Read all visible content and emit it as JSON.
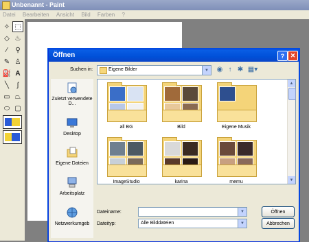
{
  "paint": {
    "title": "Unbenannt - Paint",
    "menu": [
      "Datei",
      "Bearbeiten",
      "Ansicht",
      "Bild",
      "Farben",
      "?"
    ]
  },
  "dialog": {
    "title": "Öffnen",
    "help_glyph": "?",
    "close_glyph": "✕",
    "look_in_label": "Suchen in:",
    "look_in_value": "Eigene Bilder",
    "places": [
      {
        "label": "Zuletzt verwendete D...",
        "icon": "recent-icon"
      },
      {
        "label": "Desktop",
        "icon": "desktop-icon"
      },
      {
        "label": "Eigene Dateien",
        "icon": "documents-icon"
      },
      {
        "label": "Arbeitsplatz",
        "icon": "computer-icon"
      },
      {
        "label": "Netzwerkumgeb",
        "icon": "network-icon"
      }
    ],
    "folders": [
      {
        "name": "all BG"
      },
      {
        "name": "Bild"
      },
      {
        "name": "Eigene Musik"
      },
      {
        "name": "ImageStudio"
      },
      {
        "name": "karina"
      },
      {
        "name": "memu"
      }
    ],
    "filename_label": "Dateiname:",
    "filename_value": "",
    "filetype_label": "Dateityp:",
    "filetype_value": "Alle Bilddateien",
    "open_button": "Öffnen",
    "cancel_button": "Abbrechen"
  }
}
